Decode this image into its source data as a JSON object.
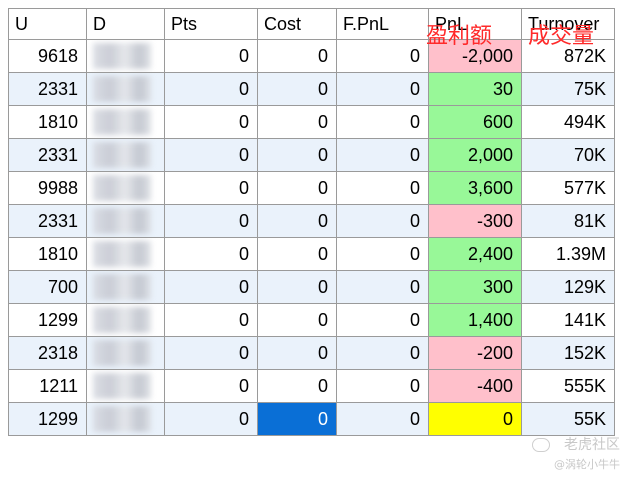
{
  "table": {
    "headers": [
      "U",
      "D",
      "Pts",
      "Cost",
      "F.PnL",
      "PnL",
      "Turnover"
    ],
    "rows": [
      {
        "U": "9618",
        "Pts": "0",
        "Cost": "0",
        "FPnL": "0",
        "PnL": "-2,000",
        "Turnover": "872K",
        "pnl_sign": "neg"
      },
      {
        "U": "2331",
        "Pts": "0",
        "Cost": "0",
        "FPnL": "0",
        "PnL": "30",
        "Turnover": "75K",
        "pnl_sign": "pos"
      },
      {
        "U": "1810",
        "Pts": "0",
        "Cost": "0",
        "FPnL": "0",
        "PnL": "600",
        "Turnover": "494K",
        "pnl_sign": "pos"
      },
      {
        "U": "2331",
        "Pts": "0",
        "Cost": "0",
        "FPnL": "0",
        "PnL": "2,000",
        "Turnover": "70K",
        "pnl_sign": "pos"
      },
      {
        "U": "9988",
        "Pts": "0",
        "Cost": "0",
        "FPnL": "0",
        "PnL": "3,600",
        "Turnover": "577K",
        "pnl_sign": "pos"
      },
      {
        "U": "2331",
        "Pts": "0",
        "Cost": "0",
        "FPnL": "0",
        "PnL": "-300",
        "Turnover": "81K",
        "pnl_sign": "neg"
      },
      {
        "U": "1810",
        "Pts": "0",
        "Cost": "0",
        "FPnL": "0",
        "PnL": "2,400",
        "Turnover": "1.39M",
        "pnl_sign": "pos"
      },
      {
        "U": "700",
        "Pts": "0",
        "Cost": "0",
        "FPnL": "0",
        "PnL": "300",
        "Turnover": "129K",
        "pnl_sign": "pos"
      },
      {
        "U": "1299",
        "Pts": "0",
        "Cost": "0",
        "FPnL": "0",
        "PnL": "1,400",
        "Turnover": "141K",
        "pnl_sign": "pos"
      },
      {
        "U": "2318",
        "Pts": "0",
        "Cost": "0",
        "FPnL": "0",
        "PnL": "-200",
        "Turnover": "152K",
        "pnl_sign": "neg"
      },
      {
        "U": "1211",
        "Pts": "0",
        "Cost": "0",
        "FPnL": "0",
        "PnL": "-400",
        "Turnover": "555K",
        "pnl_sign": "neg"
      },
      {
        "U": "1299",
        "Pts": "0",
        "Cost": "0",
        "FPnL": "0",
        "PnL": "0",
        "Turnover": "55K",
        "pnl_sign": "zero",
        "selected_cost": true
      }
    ]
  },
  "overlay": {
    "profit_label": "盈利额",
    "volume_label": "成交量"
  },
  "watermark": {
    "line1": "老虎社区",
    "line2": "@涡轮小牛牛"
  },
  "colors": {
    "pnl_positive": "#98f898",
    "pnl_negative": "#ffc0cb",
    "pnl_zero": "#ffff00",
    "selected_cell": "#0a6fd6",
    "alt_row": "#eaf2fb",
    "overlay_text": "#ff2a2a"
  }
}
